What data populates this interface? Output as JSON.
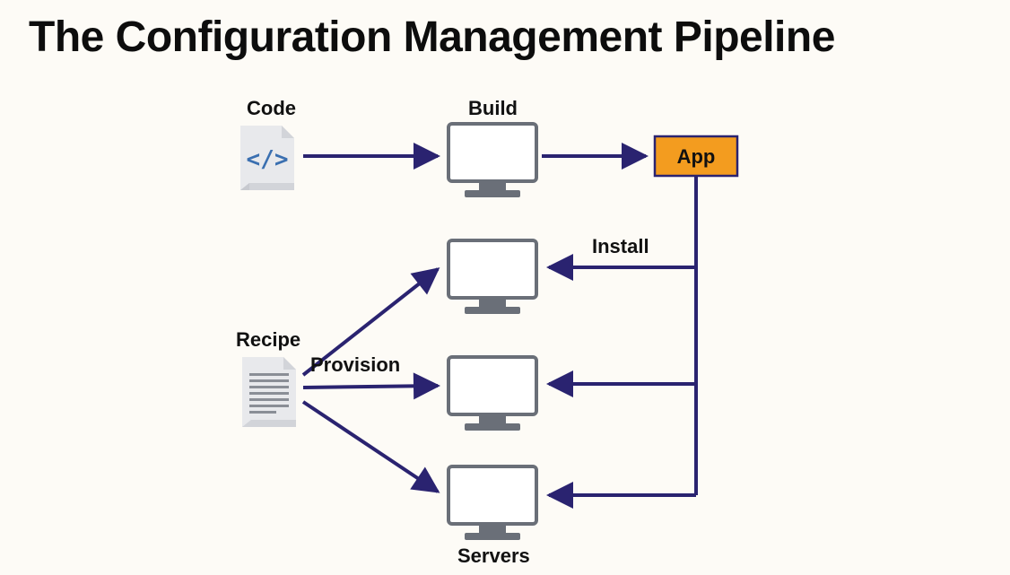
{
  "title": "The Configuration Management Pipeline",
  "nodes": {
    "code": {
      "label": "Code"
    },
    "build": {
      "label": "Build"
    },
    "app": {
      "label": "App"
    },
    "recipe": {
      "label": "Recipe"
    },
    "servers": {
      "label": "Servers"
    }
  },
  "edges": {
    "code_to_build": {},
    "build_to_app": {},
    "install": {
      "label": "Install"
    },
    "provision": {
      "label": "Provision"
    },
    "app_to_server1": {},
    "app_to_server2": {},
    "app_to_server3": {},
    "recipe_to_server1": {},
    "recipe_to_server2": {},
    "recipe_to_server3": {}
  },
  "colors": {
    "arrow": "#2a2370",
    "app_fill": "#f39c1f",
    "icon_gray": "#6a6f78",
    "code_accent": "#3a6fb0",
    "bg": "#fdfbf6"
  }
}
